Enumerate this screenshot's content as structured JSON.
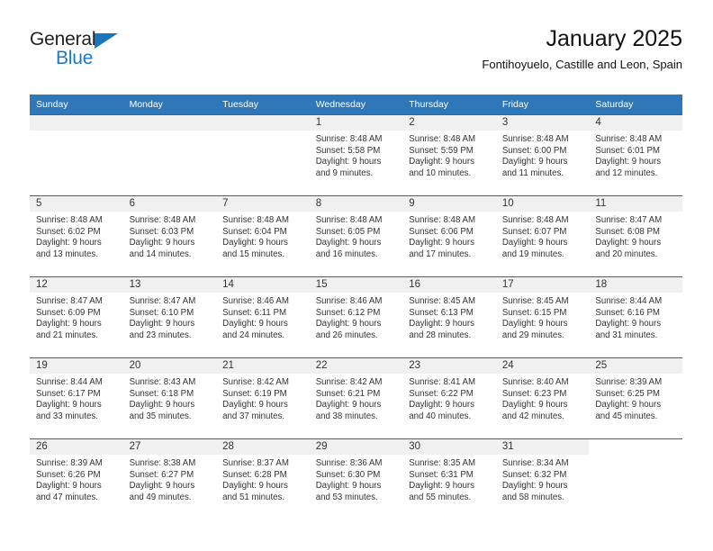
{
  "logo": {
    "word_top": "General",
    "word_bottom": "Blue",
    "triangle_color": "#1976bc",
    "blue_color": "#1f7ac4"
  },
  "header": {
    "title": "January 2025",
    "subtitle": "Fontihoyuelo, Castille and Leon, Spain",
    "accent_color": "#2e77b8",
    "row_divider_color": "#1e6bb0",
    "daynum_band_color": "#f0f0f0"
  },
  "weekdays": [
    "Sunday",
    "Monday",
    "Tuesday",
    "Wednesday",
    "Thursday",
    "Friday",
    "Saturday"
  ],
  "weeks": [
    [
      {
        "day": "",
        "empty": true
      },
      {
        "day": "",
        "empty": true
      },
      {
        "day": "",
        "empty": true
      },
      {
        "day": "1",
        "sunrise": "Sunrise: 8:48 AM",
        "sunset": "Sunset: 5:58 PM",
        "daylight1": "Daylight: 9 hours",
        "daylight2": "and 9 minutes."
      },
      {
        "day": "2",
        "sunrise": "Sunrise: 8:48 AM",
        "sunset": "Sunset: 5:59 PM",
        "daylight1": "Daylight: 9 hours",
        "daylight2": "and 10 minutes."
      },
      {
        "day": "3",
        "sunrise": "Sunrise: 8:48 AM",
        "sunset": "Sunset: 6:00 PM",
        "daylight1": "Daylight: 9 hours",
        "daylight2": "and 11 minutes."
      },
      {
        "day": "4",
        "sunrise": "Sunrise: 8:48 AM",
        "sunset": "Sunset: 6:01 PM",
        "daylight1": "Daylight: 9 hours",
        "daylight2": "and 12 minutes."
      }
    ],
    [
      {
        "day": "5",
        "sunrise": "Sunrise: 8:48 AM",
        "sunset": "Sunset: 6:02 PM",
        "daylight1": "Daylight: 9 hours",
        "daylight2": "and 13 minutes."
      },
      {
        "day": "6",
        "sunrise": "Sunrise: 8:48 AM",
        "sunset": "Sunset: 6:03 PM",
        "daylight1": "Daylight: 9 hours",
        "daylight2": "and 14 minutes."
      },
      {
        "day": "7",
        "sunrise": "Sunrise: 8:48 AM",
        "sunset": "Sunset: 6:04 PM",
        "daylight1": "Daylight: 9 hours",
        "daylight2": "and 15 minutes."
      },
      {
        "day": "8",
        "sunrise": "Sunrise: 8:48 AM",
        "sunset": "Sunset: 6:05 PM",
        "daylight1": "Daylight: 9 hours",
        "daylight2": "and 16 minutes."
      },
      {
        "day": "9",
        "sunrise": "Sunrise: 8:48 AM",
        "sunset": "Sunset: 6:06 PM",
        "daylight1": "Daylight: 9 hours",
        "daylight2": "and 17 minutes."
      },
      {
        "day": "10",
        "sunrise": "Sunrise: 8:48 AM",
        "sunset": "Sunset: 6:07 PM",
        "daylight1": "Daylight: 9 hours",
        "daylight2": "and 19 minutes."
      },
      {
        "day": "11",
        "sunrise": "Sunrise: 8:47 AM",
        "sunset": "Sunset: 6:08 PM",
        "daylight1": "Daylight: 9 hours",
        "daylight2": "and 20 minutes."
      }
    ],
    [
      {
        "day": "12",
        "sunrise": "Sunrise: 8:47 AM",
        "sunset": "Sunset: 6:09 PM",
        "daylight1": "Daylight: 9 hours",
        "daylight2": "and 21 minutes."
      },
      {
        "day": "13",
        "sunrise": "Sunrise: 8:47 AM",
        "sunset": "Sunset: 6:10 PM",
        "daylight1": "Daylight: 9 hours",
        "daylight2": "and 23 minutes."
      },
      {
        "day": "14",
        "sunrise": "Sunrise: 8:46 AM",
        "sunset": "Sunset: 6:11 PM",
        "daylight1": "Daylight: 9 hours",
        "daylight2": "and 24 minutes."
      },
      {
        "day": "15",
        "sunrise": "Sunrise: 8:46 AM",
        "sunset": "Sunset: 6:12 PM",
        "daylight1": "Daylight: 9 hours",
        "daylight2": "and 26 minutes."
      },
      {
        "day": "16",
        "sunrise": "Sunrise: 8:45 AM",
        "sunset": "Sunset: 6:13 PM",
        "daylight1": "Daylight: 9 hours",
        "daylight2": "and 28 minutes."
      },
      {
        "day": "17",
        "sunrise": "Sunrise: 8:45 AM",
        "sunset": "Sunset: 6:15 PM",
        "daylight1": "Daylight: 9 hours",
        "daylight2": "and 29 minutes."
      },
      {
        "day": "18",
        "sunrise": "Sunrise: 8:44 AM",
        "sunset": "Sunset: 6:16 PM",
        "daylight1": "Daylight: 9 hours",
        "daylight2": "and 31 minutes."
      }
    ],
    [
      {
        "day": "19",
        "sunrise": "Sunrise: 8:44 AM",
        "sunset": "Sunset: 6:17 PM",
        "daylight1": "Daylight: 9 hours",
        "daylight2": "and 33 minutes."
      },
      {
        "day": "20",
        "sunrise": "Sunrise: 8:43 AM",
        "sunset": "Sunset: 6:18 PM",
        "daylight1": "Daylight: 9 hours",
        "daylight2": "and 35 minutes."
      },
      {
        "day": "21",
        "sunrise": "Sunrise: 8:42 AM",
        "sunset": "Sunset: 6:19 PM",
        "daylight1": "Daylight: 9 hours",
        "daylight2": "and 37 minutes."
      },
      {
        "day": "22",
        "sunrise": "Sunrise: 8:42 AM",
        "sunset": "Sunset: 6:21 PM",
        "daylight1": "Daylight: 9 hours",
        "daylight2": "and 38 minutes."
      },
      {
        "day": "23",
        "sunrise": "Sunrise: 8:41 AM",
        "sunset": "Sunset: 6:22 PM",
        "daylight1": "Daylight: 9 hours",
        "daylight2": "and 40 minutes."
      },
      {
        "day": "24",
        "sunrise": "Sunrise: 8:40 AM",
        "sunset": "Sunset: 6:23 PM",
        "daylight1": "Daylight: 9 hours",
        "daylight2": "and 42 minutes."
      },
      {
        "day": "25",
        "sunrise": "Sunrise: 8:39 AM",
        "sunset": "Sunset: 6:25 PM",
        "daylight1": "Daylight: 9 hours",
        "daylight2": "and 45 minutes."
      }
    ],
    [
      {
        "day": "26",
        "sunrise": "Sunrise: 8:39 AM",
        "sunset": "Sunset: 6:26 PM",
        "daylight1": "Daylight: 9 hours",
        "daylight2": "and 47 minutes."
      },
      {
        "day": "27",
        "sunrise": "Sunrise: 8:38 AM",
        "sunset": "Sunset: 6:27 PM",
        "daylight1": "Daylight: 9 hours",
        "daylight2": "and 49 minutes."
      },
      {
        "day": "28",
        "sunrise": "Sunrise: 8:37 AM",
        "sunset": "Sunset: 6:28 PM",
        "daylight1": "Daylight: 9 hours",
        "daylight2": "and 51 minutes."
      },
      {
        "day": "29",
        "sunrise": "Sunrise: 8:36 AM",
        "sunset": "Sunset: 6:30 PM",
        "daylight1": "Daylight: 9 hours",
        "daylight2": "and 53 minutes."
      },
      {
        "day": "30",
        "sunrise": "Sunrise: 8:35 AM",
        "sunset": "Sunset: 6:31 PM",
        "daylight1": "Daylight: 9 hours",
        "daylight2": "and 55 minutes."
      },
      {
        "day": "31",
        "sunrise": "Sunrise: 8:34 AM",
        "sunset": "Sunset: 6:32 PM",
        "daylight1": "Daylight: 9 hours",
        "daylight2": "and 58 minutes."
      },
      {
        "day": "",
        "empty": true,
        "blank": true
      }
    ]
  ]
}
